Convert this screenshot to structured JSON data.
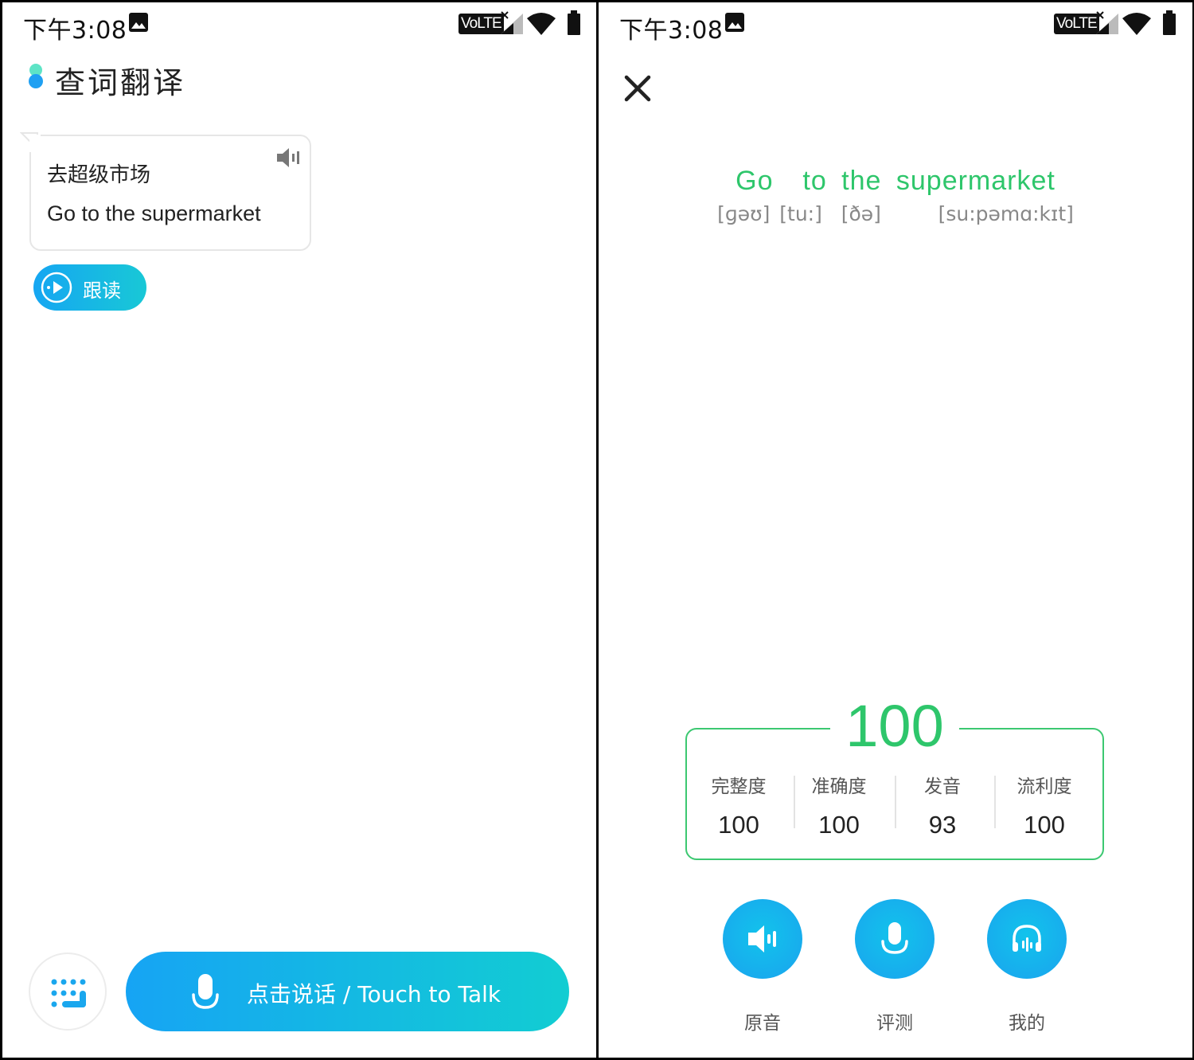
{
  "status_bar": {
    "time": "下午3:08",
    "network_badge": "VoLTE",
    "icons": [
      "gallery-icon",
      "signal-icon",
      "wifi-icon",
      "battery-icon"
    ]
  },
  "translate_screen": {
    "title": "查词翻译",
    "bubble": {
      "source_text": "去超级市场",
      "translated_text": "Go to the supermarket"
    },
    "follow_button_label": "跟读",
    "talk_button_label": "点击说话 / Touch to Talk"
  },
  "evaluation_screen": {
    "sentence": "Go  to the supermarket",
    "phonetics": "[ɡəʊ] [tu:]  [ðə]      [su:pəmɑ:kɪt]",
    "total_score": "100",
    "metrics": [
      {
        "label": "完整度",
        "value": "100"
      },
      {
        "label": "准确度",
        "value": "100"
      },
      {
        "label": "发音",
        "value": "93"
      },
      {
        "label": "流利度",
        "value": "100"
      }
    ],
    "actions": [
      {
        "label": "原音",
        "icon": "speaker-icon"
      },
      {
        "label": "评测",
        "icon": "microphone-icon"
      },
      {
        "label": "我的",
        "icon": "headphones-icon"
      }
    ]
  },
  "colors": {
    "accent_blue": "#16a6f2",
    "accent_teal": "#18c8d6",
    "score_green": "#2ec66b"
  }
}
